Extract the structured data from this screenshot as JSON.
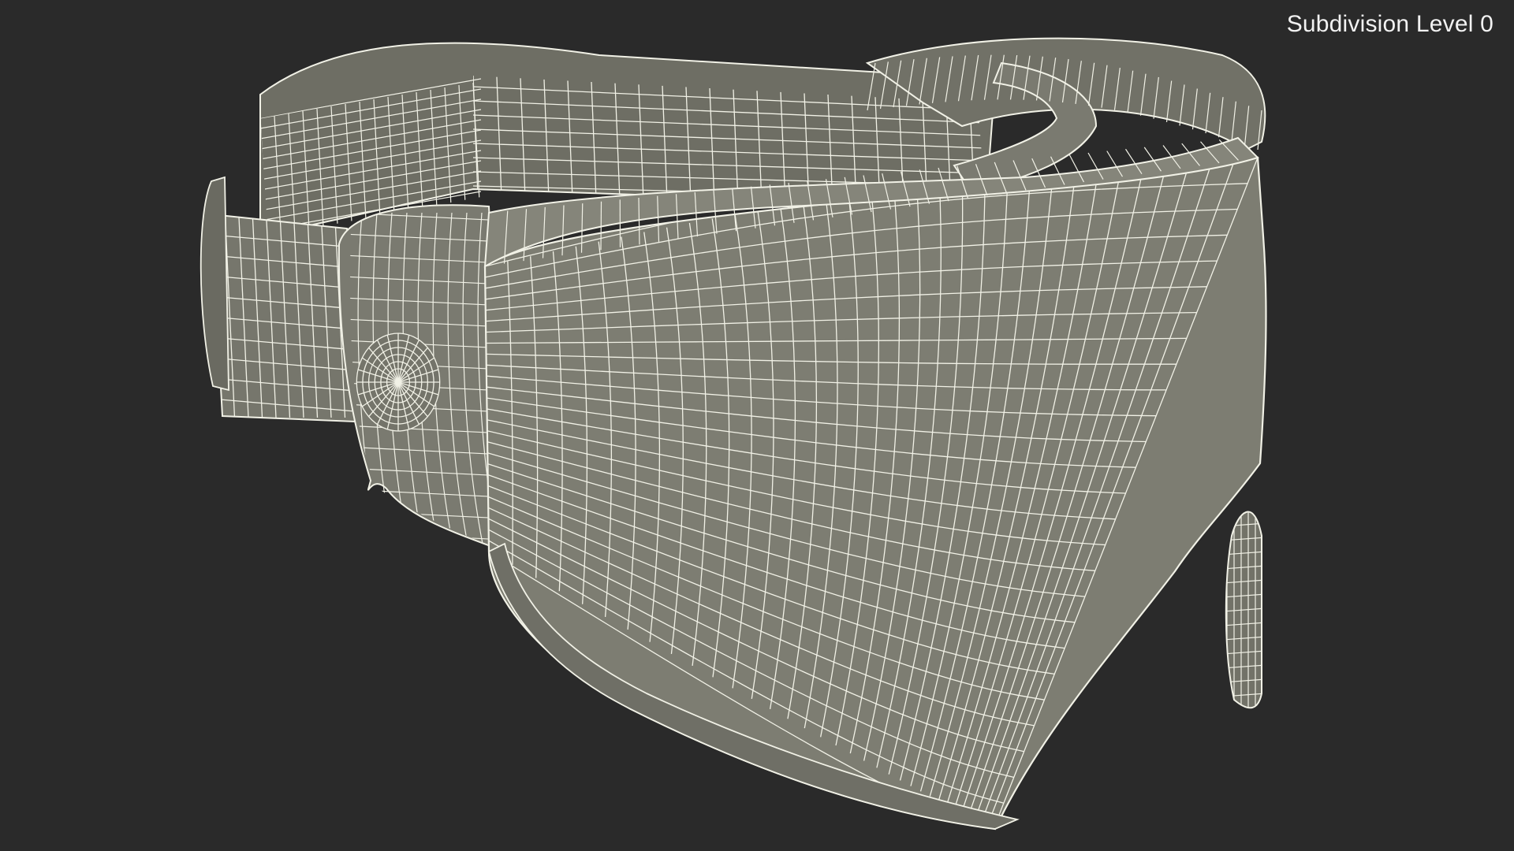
{
  "overlay": {
    "subdivision_label": "Subdivision Level 0"
  },
  "render": {
    "subject": "headset-wireframe-model",
    "background_color": "#2a2a2a",
    "surface_color": "#7d7d72",
    "shadow_surface_color": "#65655c",
    "wire_color": "#f1f1e6"
  }
}
